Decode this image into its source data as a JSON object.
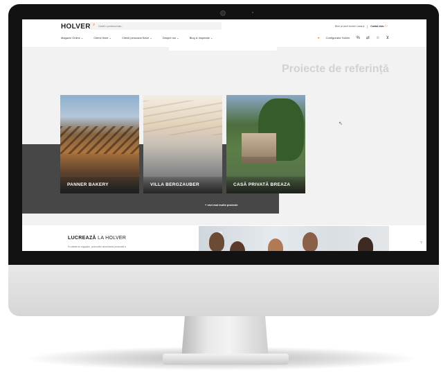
{
  "header": {
    "logo_text": "HOLVER",
    "search_placeholder": "Caută o produsul sau...",
    "account_text": "Bine ai venit Andrei Lazarui",
    "contact_text": "Contul meu",
    "nav": [
      "Magazin Online ⌄",
      "Clienți firme ⌄",
      "Clienți persoane fizice ⌄",
      "Despre noi ⌄",
      "Blog & Inspirație ⌄"
    ],
    "configurator_label": "Configurator Holver",
    "icons": [
      "percent-icon",
      "compare-icon",
      "star-icon",
      "cart-icon"
    ]
  },
  "section": {
    "title": "Proiecte de referință"
  },
  "projects": [
    {
      "name": "PANNER BAKERY"
    },
    {
      "name": "VILLA BERGZAUBER"
    },
    {
      "name": "CASĂ PRIVATĂ BREAZA"
    }
  ],
  "more_link": "+ vezi mai multe proiecte",
  "work": {
    "title_bold": "LUCREAZĂ",
    "title_rest": " LA HOLVER",
    "desc": "În calitate de angajator, promovăm dezvoltarea personală a"
  },
  "help_text": "?",
  "colors": {
    "accent": "#e96b2c",
    "dark_band": "#474748",
    "title_gray": "#d2d2d2"
  }
}
